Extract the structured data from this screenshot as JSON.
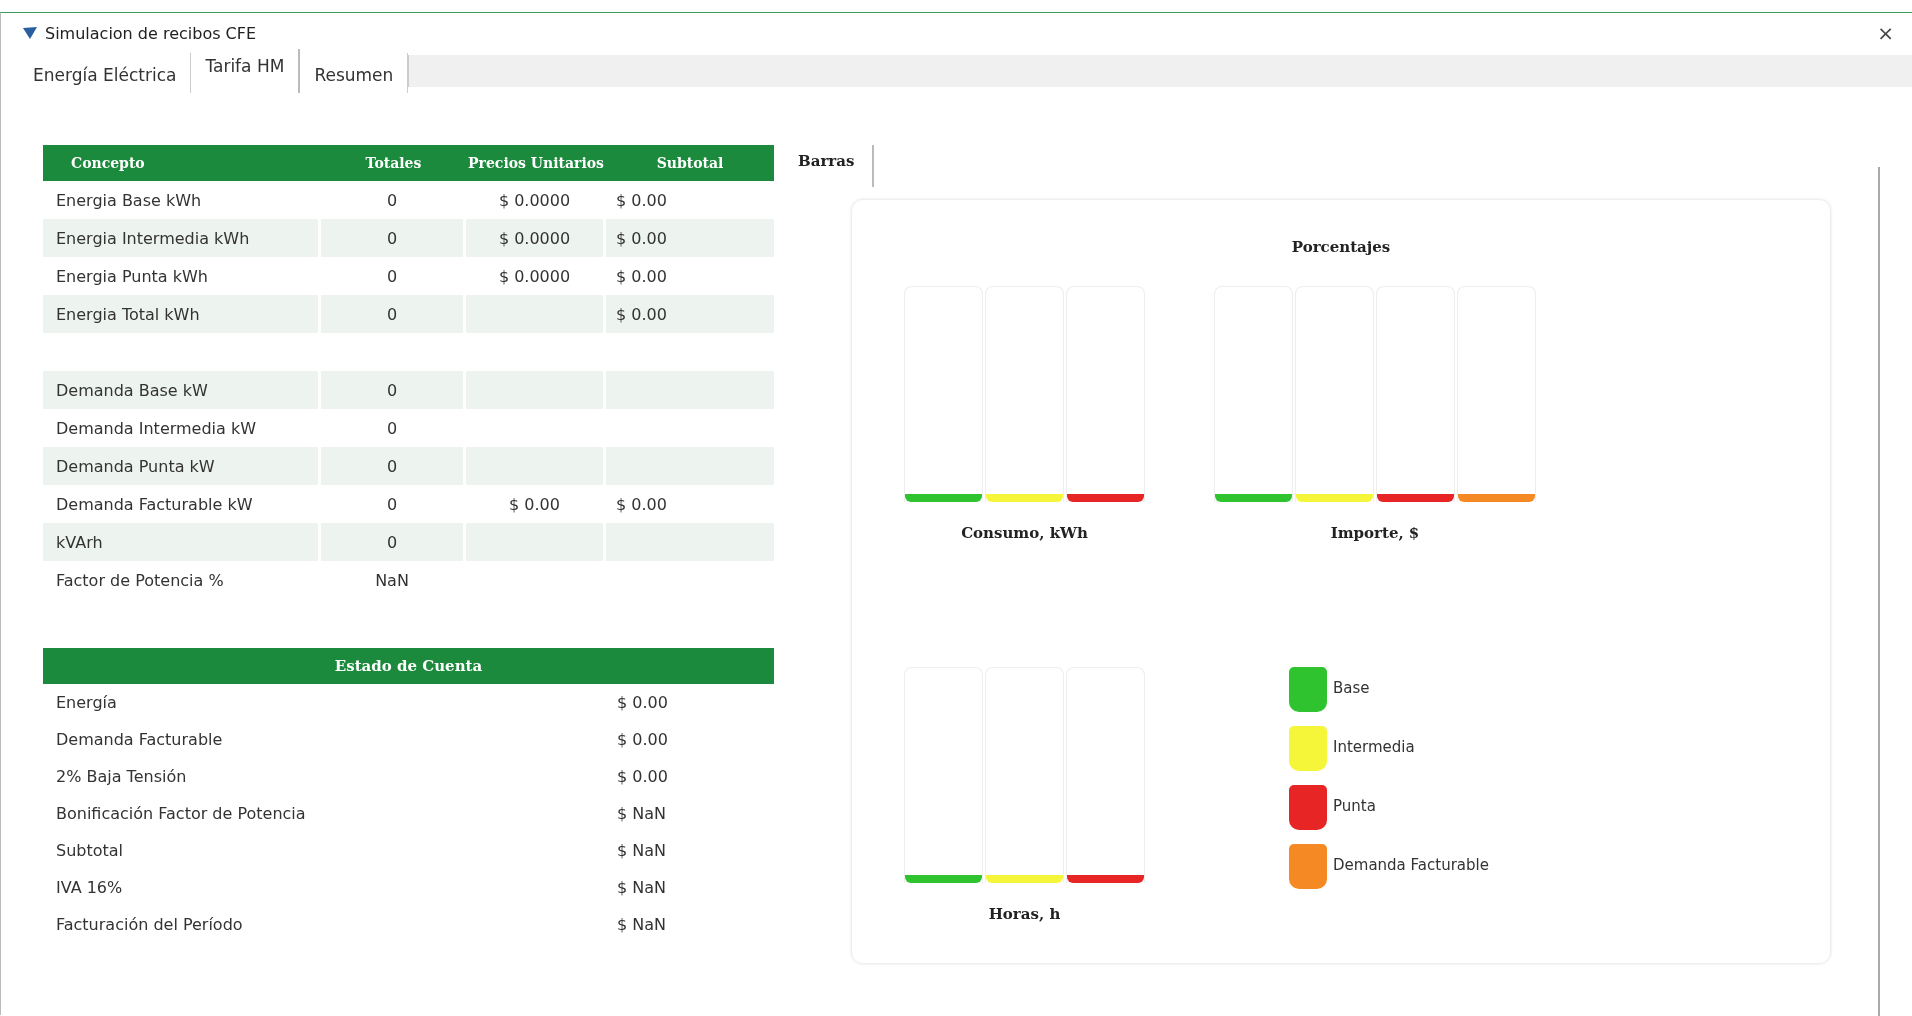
{
  "window": {
    "title": "Simulacion de recibos CFE",
    "close": "×"
  },
  "tabs": [
    {
      "label": "Energía Eléctrica",
      "selected": false
    },
    {
      "label": "Tarifa HM",
      "selected": true
    },
    {
      "label": "Resumen",
      "selected": false
    }
  ],
  "concept_table": {
    "columns": [
      "Concepto",
      "Totales",
      "Precios Unitarios",
      "Subtotal"
    ],
    "groups": [
      [
        {
          "cells": [
            "Energia Base kWh",
            "0",
            "$ 0.0000",
            "$ 0.00"
          ],
          "shaded": false
        },
        {
          "cells": [
            "Energia Intermedia kWh",
            "0",
            "$ 0.0000",
            "$ 0.00"
          ],
          "shaded": true
        },
        {
          "cells": [
            "Energia Punta kWh",
            "0",
            "$ 0.0000",
            "$ 0.00"
          ],
          "shaded": false
        },
        {
          "cells": [
            "Energia Total kWh",
            "0",
            null,
            "$ 0.00"
          ],
          "shaded": true
        }
      ],
      [
        {
          "cells": [
            "Demanda Base kW",
            "0",
            null,
            null
          ],
          "shaded": true
        },
        {
          "cells": [
            "Demanda Intermedia kW",
            "0",
            null,
            null
          ],
          "shaded": false
        },
        {
          "cells": [
            "Demanda Punta kW",
            "0",
            null,
            null
          ],
          "shaded": true
        },
        {
          "cells": [
            "Demanda Facturable kW",
            "0",
            "$ 0.00",
            "$ 0.00"
          ],
          "shaded": false
        },
        {
          "cells": [
            "kVArh",
            "0",
            null,
            null
          ],
          "shaded": true
        },
        {
          "cells": [
            "Factor de Potencia %",
            "NaN",
            null,
            null
          ],
          "shaded": false
        }
      ]
    ]
  },
  "account_table": {
    "title": "Estado de Cuenta",
    "rows": [
      {
        "label": "Energía",
        "value": "$ 0.00"
      },
      {
        "label": "Demanda Facturable",
        "value": "$ 0.00"
      },
      {
        "label": "2% Baja Tensión",
        "value": "$ 0.00"
      },
      {
        "label": "Bonificación Factor de Potencia",
        "value": "$ NaN"
      },
      {
        "label": "Subtotal",
        "value": "$ NaN"
      },
      {
        "label": "IVA 16%",
        "value": "$ NaN"
      },
      {
        "label": "Facturación del Período",
        "value": "$ NaN"
      }
    ]
  },
  "chart_tabs": [
    {
      "label": "Barras",
      "selected": true
    }
  ],
  "chart_panel": {
    "title": "Porcentajes",
    "bar_groups": [
      {
        "label": "Consumo, kWh",
        "bars": [
          {
            "color": "#2fc42f",
            "level": 0
          },
          {
            "color": "#f5f53a",
            "level": 0
          },
          {
            "color": "#e82525",
            "level": 0
          }
        ]
      },
      {
        "label": "Importe, $",
        "bars": [
          {
            "color": "#2fc42f",
            "level": 0
          },
          {
            "color": "#f5f53a",
            "level": 0
          },
          {
            "color": "#e82525",
            "level": 0
          },
          {
            "color": "#f58a25",
            "level": 0
          }
        ]
      },
      {
        "label": "Horas, h",
        "bars": [
          {
            "color": "#2fc42f",
            "level": 0
          },
          {
            "color": "#f5f53a",
            "level": 0
          },
          {
            "color": "#e82525",
            "level": 0
          }
        ]
      }
    ],
    "legend": [
      {
        "label": "Base",
        "color": "#2fc42f"
      },
      {
        "label": "Intermedia",
        "color": "#f5f53a"
      },
      {
        "label": "Punta",
        "color": "#e82525"
      },
      {
        "label": "Demanda Facturable",
        "color": "#f58a25"
      }
    ]
  }
}
